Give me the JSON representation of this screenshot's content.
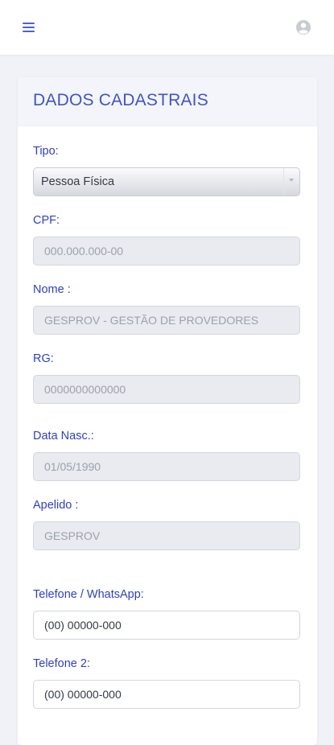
{
  "header": {
    "menu_icon": "menu-icon",
    "user_icon": "user-circle-icon"
  },
  "card": {
    "title": "DADOS CADASTRAIS"
  },
  "form": {
    "tipo": {
      "label": "Tipo:",
      "value": "Pessoa Física"
    },
    "cpf": {
      "label": "CPF:",
      "value": "000.000.000-00"
    },
    "nome": {
      "label": "Nome :",
      "value": "GESPROV - GESTÃO DE PROVEDORES"
    },
    "rg": {
      "label": "RG:",
      "value": "0000000000000"
    },
    "data_nasc": {
      "label": "Data Nasc.:",
      "value": "01/05/1990"
    },
    "apelido": {
      "label": "Apelido :",
      "value": "GESPROV"
    },
    "telefone_whatsapp": {
      "label": "Telefone / WhatsApp:",
      "value": "(00) 00000-000"
    },
    "telefone2": {
      "label": "Telefone 2:",
      "value": "(00) 00000-000"
    }
  },
  "colors": {
    "accent": "#3f54c9",
    "label": "#2f3fc2",
    "background": "#f1f2f8"
  }
}
